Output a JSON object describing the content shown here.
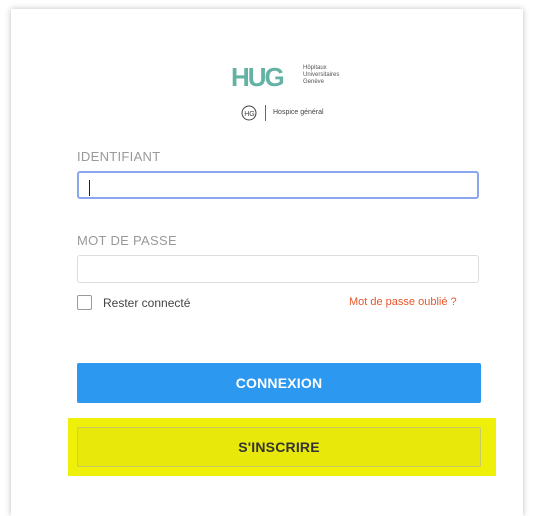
{
  "logos": {
    "hug_text_line1": "Hôpitaux",
    "hug_text_line2": "Universitaires",
    "hug_text_line3": "Genève",
    "hug_color": "#63b2a3",
    "hospice_label": "Hospice général"
  },
  "form": {
    "identifiant_label": "IDENTIFIANT",
    "identifiant_value": "",
    "password_label": "MOT DE PASSE",
    "password_value": "",
    "remember_label": "Rester connecté",
    "remember_checked": false,
    "forgot_label": "Mot de passe oublié ?",
    "login_button": "CONNEXION",
    "signup_button": "S'INSCRIRE"
  },
  "colors": {
    "primary": "#2d98f0",
    "link": "#e8562a",
    "highlight": "#eef00a"
  }
}
